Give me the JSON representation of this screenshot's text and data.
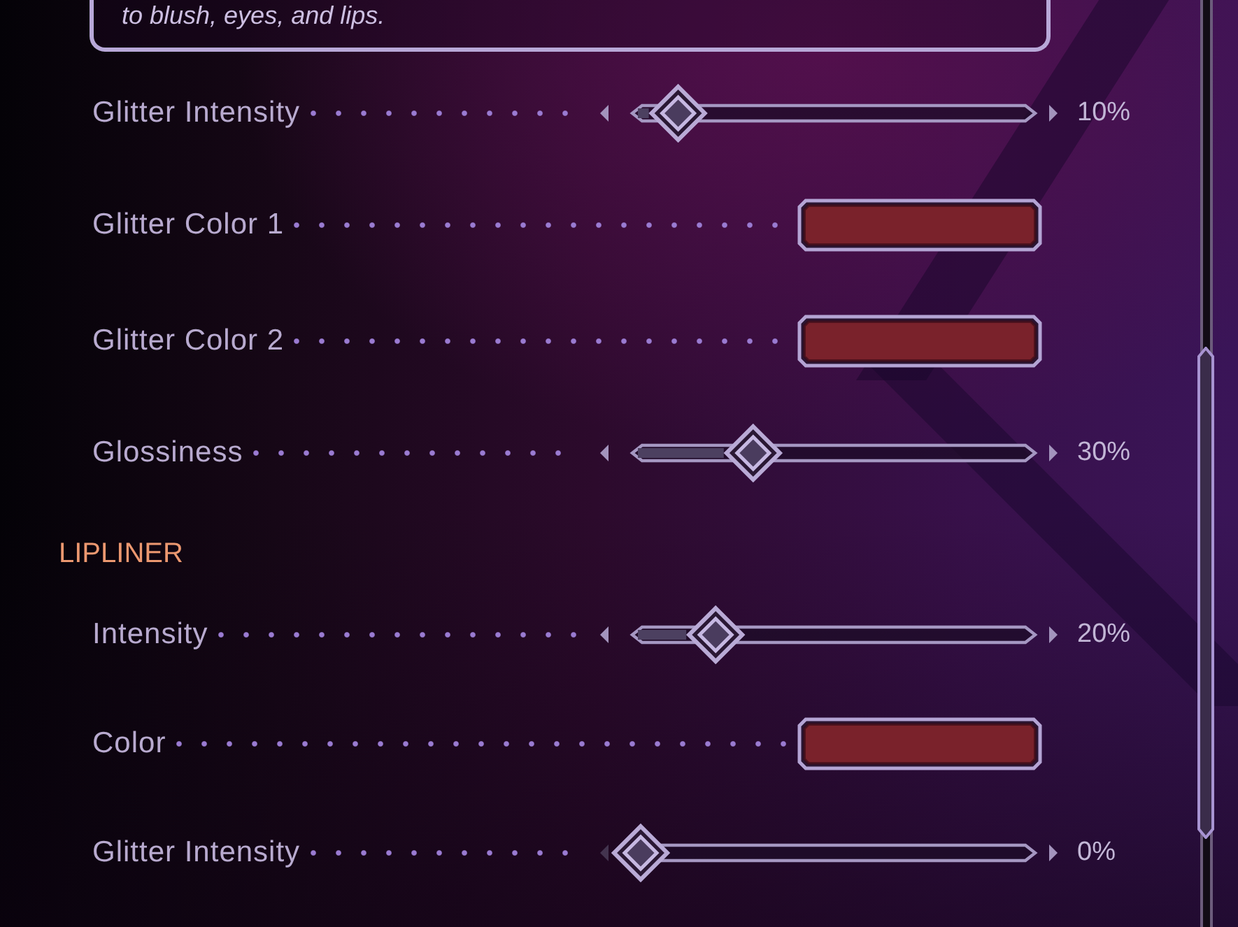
{
  "description_card": {
    "text": "to blush, eyes, and lips."
  },
  "sections": [
    {
      "rows": [
        {
          "kind": "slider",
          "label": "Glitter Intensity",
          "level": 0.1,
          "reading": "10%"
        },
        {
          "kind": "color",
          "label": "Glitter Color 1",
          "color": "#7a222b"
        },
        {
          "kind": "color",
          "label": "Glitter Color 2",
          "color": "#7a222b"
        },
        {
          "kind": "slider",
          "label": "Glossiness",
          "level": 0.3,
          "reading": "30%"
        }
      ]
    },
    {
      "heading": "LIPLINER",
      "rows": [
        {
          "kind": "slider",
          "label": "Intensity",
          "level": 0.2,
          "reading": "20%"
        },
        {
          "kind": "color",
          "label": "Color",
          "color": "#7a222b"
        },
        {
          "kind": "slider",
          "label": "Glitter Intensity",
          "level": 0,
          "reading": "0%"
        }
      ]
    }
  ]
}
